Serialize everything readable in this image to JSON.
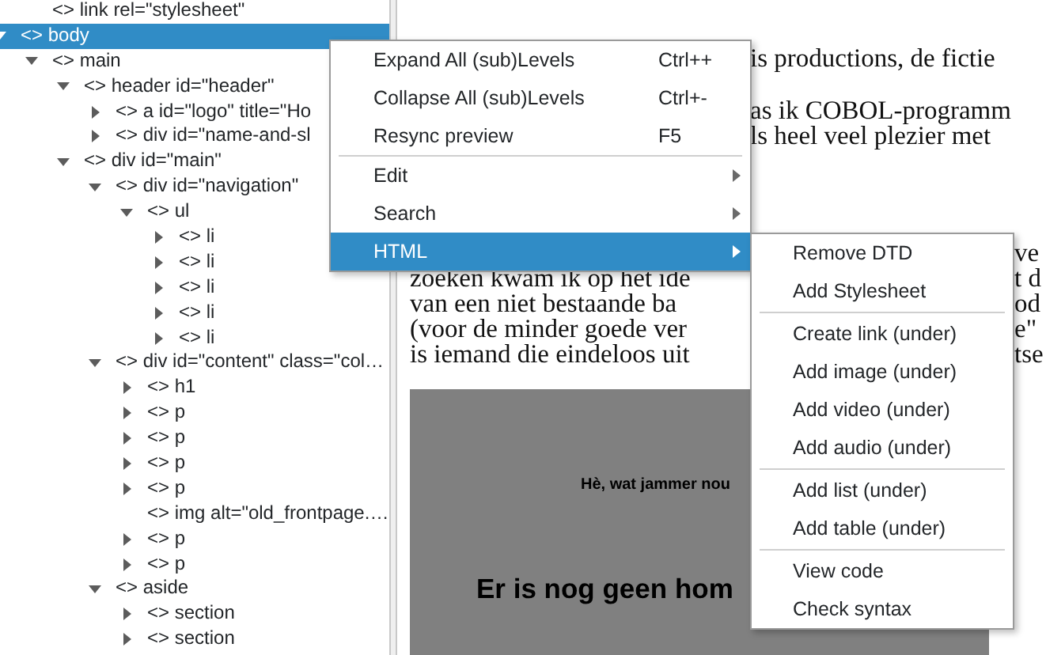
{
  "tree": [
    {
      "children": [
        {
          "label": "<> link rel=\"stylesheet\"",
          "selected": false
        }
      ]
    },
    {
      "label": "<> body",
      "selected": true,
      "expanded": true,
      "children": [
        {
          "label": "<> main",
          "selected": false,
          "expanded": true,
          "children": [
            {
              "label": "<> header id=\"header\"",
              "selected": false,
              "expanded": true,
              "children": [
                {
                  "label": "<> a id=\"logo\" title=\"Ho",
                  "selected": false,
                  "expanded": false
                },
                {
                  "label": "<> div id=\"name-and-sl",
                  "selected": false,
                  "expanded": false
                }
              ]
            },
            {
              "label": "<> div id=\"main\"",
              "selected": false,
              "expanded": true,
              "children": [
                {
                  "label": "<> div id=\"navigation\"",
                  "selected": false,
                  "expanded": true,
                  "children": [
                    {
                      "label": "<> ul",
                      "selected": false,
                      "expanded": true,
                      "children": [
                        {
                          "label": "<> li",
                          "selected": false,
                          "expanded": false
                        },
                        {
                          "label": "<> li",
                          "selected": false,
                          "expanded": false
                        },
                        {
                          "label": "<> li",
                          "selected": false,
                          "expanded": false
                        },
                        {
                          "label": "<> li",
                          "selected": false,
                          "expanded": false
                        },
                        {
                          "label": "<> li",
                          "selected": false,
                          "expanded": false
                        }
                      ]
                    }
                  ]
                },
                {
                  "label": "<> div id=\"content\" class=\"col…",
                  "selected": false,
                  "expanded": true,
                  "children": [
                    {
                      "label": "<> h1",
                      "selected": false,
                      "expanded": false
                    },
                    {
                      "label": "<> p",
                      "selected": false,
                      "expanded": false
                    },
                    {
                      "label": "<> p",
                      "selected": false,
                      "expanded": false
                    },
                    {
                      "label": "<> p",
                      "selected": false,
                      "expanded": false
                    },
                    {
                      "label": "<> p",
                      "selected": false,
                      "expanded": false
                    },
                    {
                      "label": "<> img alt=\"old_frontpage.…",
                      "selected": false
                    },
                    {
                      "label": "<> p",
                      "selected": false,
                      "expanded": false
                    },
                    {
                      "label": "<> p",
                      "selected": false,
                      "expanded": false
                    }
                  ]
                },
                {
                  "label": "<> aside",
                  "selected": false,
                  "expanded": true,
                  "children": [
                    {
                      "label": "<> section",
                      "selected": false,
                      "expanded": false
                    },
                    {
                      "label": "<> section",
                      "selected": false,
                      "expanded": false
                    }
                  ]
                }
              ]
            }
          ]
        }
      ]
    }
  ],
  "preview": {
    "paragraphs": [
      [
        {
          "middle": "is productions, de fictie"
        }
      ],
      [
        {
          "middle": "as ik COBOL-programm"
        },
        {
          "middle": "ls heel veel plezier met"
        }
      ],
      [
        {
          "right": "ve"
        },
        {
          "left": "zoeken kwam ik op het ide",
          "right": "t d"
        },
        {
          "left": "van een niet bestaande ba",
          "right": "od"
        },
        {
          "left": "(voor de minder goede ver",
          "right": "e\""
        },
        {
          "left": "is iemand die eindeloos uit",
          "right": "tse"
        }
      ]
    ],
    "banner": {
      "text": "Hè, wat jammer nou",
      "heading": "Er is nog geen hom"
    }
  },
  "context_menu": {
    "items": [
      {
        "kind": "command",
        "label": "Expand All (sub)Levels",
        "shortcut": "Ctrl++",
        "selected": false
      },
      {
        "kind": "command",
        "label": "Collapse All (sub)Levels",
        "shortcut": "Ctrl+-",
        "selected": false
      },
      {
        "kind": "command",
        "label": "Resync preview",
        "shortcut": "F5",
        "selected": false
      },
      {
        "kind": "separator"
      },
      {
        "kind": "submenu",
        "label": "Edit",
        "selected": false
      },
      {
        "kind": "submenu",
        "label": "Search",
        "selected": false
      },
      {
        "kind": "submenu",
        "label": "HTML",
        "selected": true
      }
    ]
  },
  "submenu": {
    "items": [
      {
        "kind": "command",
        "label": "Remove DTD"
      },
      {
        "kind": "command",
        "label": "Add Stylesheet"
      },
      {
        "kind": "separator"
      },
      {
        "kind": "command",
        "label": "Create link (under)"
      },
      {
        "kind": "command",
        "label": "Add image (under)"
      },
      {
        "kind": "command",
        "label": "Add video (under)"
      },
      {
        "kind": "command",
        "label": "Add audio (under)"
      },
      {
        "kind": "separator"
      },
      {
        "kind": "command",
        "label": "Add list (under)"
      },
      {
        "kind": "command",
        "label": "Add table (under)"
      },
      {
        "kind": "separator"
      },
      {
        "kind": "command",
        "label": "View code"
      },
      {
        "kind": "command",
        "label": "Check syntax"
      }
    ]
  }
}
